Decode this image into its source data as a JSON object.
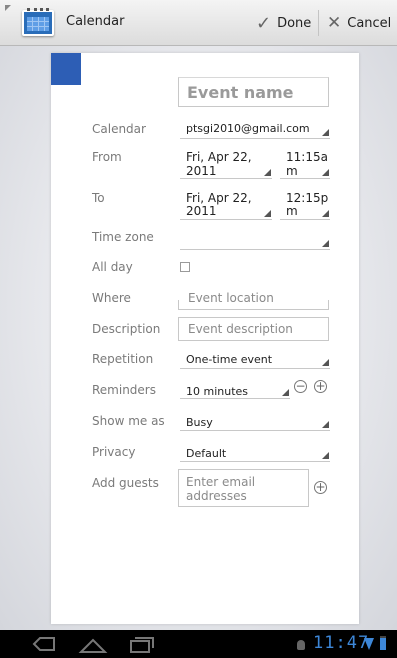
{
  "actionbar": {
    "title": "Calendar",
    "done_label": "Done",
    "cancel_label": "Cancel"
  },
  "event": {
    "color": "#2d5eb5",
    "name_placeholder": "Event name"
  },
  "fields": {
    "calendar": {
      "label": "Calendar",
      "value": "ptsgi2010@gmail.com"
    },
    "from": {
      "label": "From",
      "date_line1": "Fri, Apr 22,",
      "date_line2": "2011",
      "time_line1": "11:15a",
      "time_line2": "m"
    },
    "to": {
      "label": "To",
      "date_line1": "Fri, Apr 22,",
      "date_line2": "2011",
      "time_line1": "12:15p",
      "time_line2": "m"
    },
    "timezone": {
      "label": "Time zone",
      "value": ""
    },
    "allday": {
      "label": "All day",
      "checked": false
    },
    "where": {
      "label": "Where",
      "placeholder": "Event location"
    },
    "description": {
      "label": "Description",
      "placeholder": "Event description"
    },
    "repetition": {
      "label": "Repetition",
      "value": "One-time event"
    },
    "reminders": {
      "label": "Reminders",
      "value": "10 minutes"
    },
    "showmeas": {
      "label": "Show me as",
      "value": "Busy"
    },
    "privacy": {
      "label": "Privacy",
      "value": "Default"
    },
    "guests": {
      "label": "Add guests",
      "placeholder_line1": "Enter email",
      "placeholder_line2": "addresses"
    }
  },
  "statusbar": {
    "time": "11:47",
    "accent": "#3d87d8"
  },
  "icons": [
    "calendar-app-icon",
    "checkmark-icon",
    "close-icon",
    "minus-circle-icon",
    "plus-circle-icon",
    "back-icon",
    "home-icon",
    "recent-apps-icon",
    "wifi-icon",
    "battery-icon"
  ]
}
